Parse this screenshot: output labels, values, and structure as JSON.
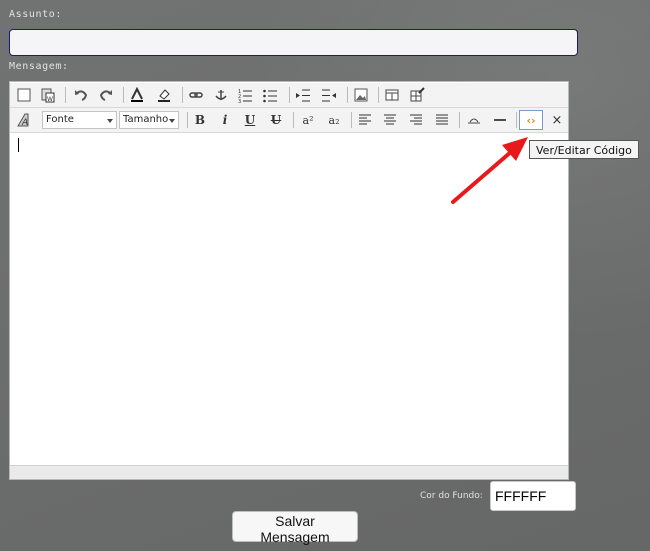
{
  "form": {
    "subject_label": "Assunto:",
    "subject_value": "",
    "message_label": "Mensagem:",
    "background_color_label": "Cor do Fundo:",
    "background_color_value": "FFFFFF",
    "save_label": "Salvar Mensagem"
  },
  "editor": {
    "font_select": "Fonte",
    "size_select": "Tamanho",
    "tooltip": "Ver/Editar  Código",
    "toolbar_row1_icons": [
      "new-document-icon",
      "paste-word-icon",
      "undo-icon",
      "redo-icon",
      "text-color-icon",
      "background-color-icon",
      "link-icon",
      "anchor-icon",
      "ordered-list-icon",
      "unordered-list-icon",
      "indent-icon",
      "outdent-icon",
      "image-icon",
      "table-icon",
      "table-edit-icon"
    ],
    "toolbar_row2_icons": [
      "remove-format-icon",
      "bold-icon",
      "italic-icon",
      "underline-icon",
      "strikethrough-icon",
      "superscript-icon",
      "subscript-icon",
      "align-left-icon",
      "align-center-icon",
      "align-right-icon",
      "justify-icon",
      "horizontal-rule-icon",
      "line-icon",
      "code-view-icon",
      "close-icon"
    ],
    "bold": "B",
    "italic": "i",
    "underline": "U",
    "strike": "U",
    "superscript": "a²",
    "subscript": "a₂",
    "code_glyph": "‹›",
    "close_glyph": "×"
  },
  "colors": {
    "background": "#6c6d6d",
    "subject_border": "#1a1a7a",
    "annotation_arrow": "#e8191b",
    "code_icon": "#e08a18"
  }
}
